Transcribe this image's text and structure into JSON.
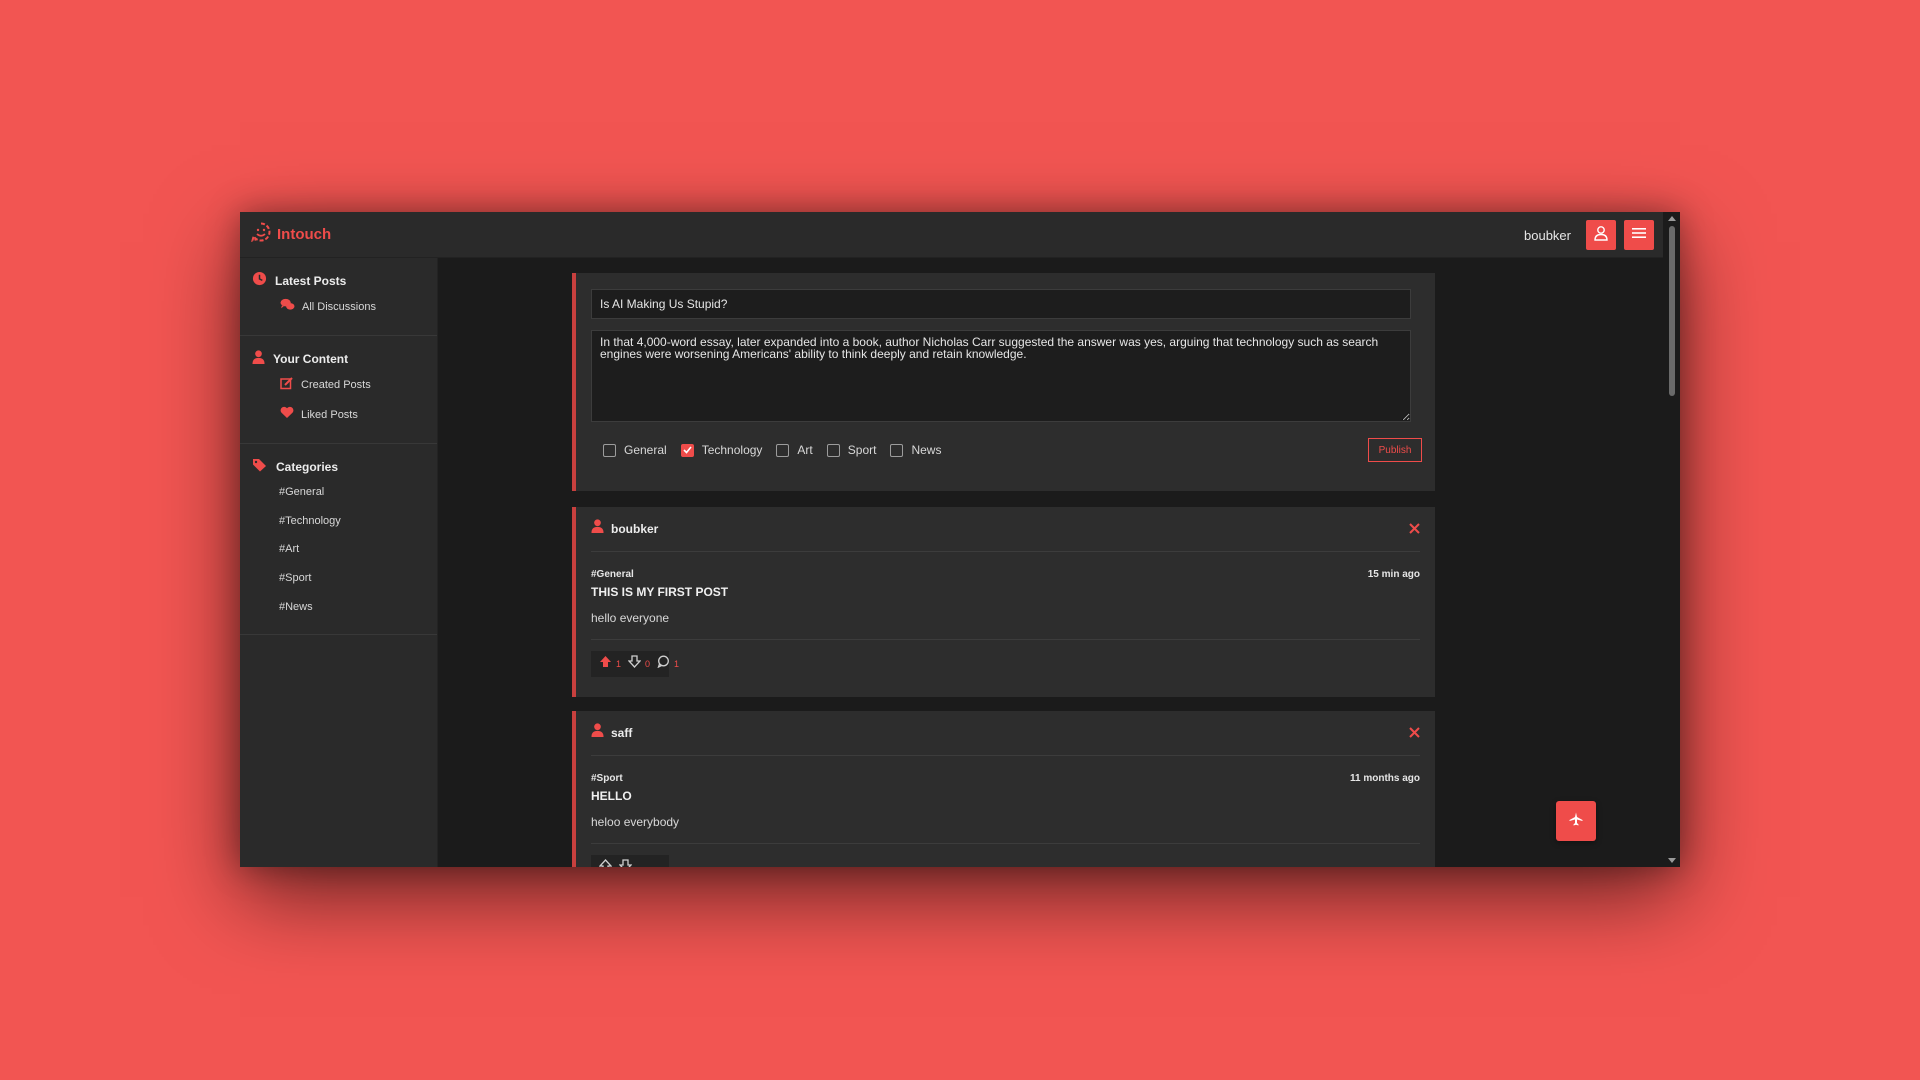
{
  "header": {
    "brand": "Intouch",
    "username": "boubker",
    "icons": {
      "logo": "smiley-chat-icon",
      "profile": "user-icon",
      "menu": "hamburger-icon"
    }
  },
  "sidebar": {
    "latest": {
      "title": "Latest Posts",
      "items": [
        {
          "label": "All Discussions",
          "icon": "discussions-icon"
        }
      ]
    },
    "content": {
      "title": "Your Content",
      "items": [
        {
          "label": "Created Posts",
          "icon": "edit-icon"
        },
        {
          "label": "Liked Posts",
          "icon": "heart-icon"
        }
      ]
    },
    "categories": {
      "title": "Categories",
      "items": [
        "#General",
        "#Technology",
        "#Art",
        "#Sport",
        "#News"
      ]
    }
  },
  "composer": {
    "title_value": "Is AI Making Us Stupid?",
    "body_value": "In that 4,000-word essay, later expanded into a book, author Nicholas Carr suggested the answer was yes, arguing that technology such as search engines were worsening Americans' ability to think deeply and retain knowledge.",
    "categories": [
      {
        "label": "General",
        "checked": false
      },
      {
        "label": "Technology",
        "checked": true
      },
      {
        "label": "Art",
        "checked": false
      },
      {
        "label": "Sport",
        "checked": false
      },
      {
        "label": "News",
        "checked": false
      }
    ],
    "publish_label": "Publish"
  },
  "posts": [
    {
      "author": "boubker",
      "category": "#General",
      "time": "15 min ago",
      "title": "THIS IS MY FIRST POST",
      "body": "hello everyone",
      "likes": "1",
      "dislikes": "0",
      "comments": "1"
    },
    {
      "author": "saff",
      "category": "#Sport",
      "time": "11 months ago",
      "title": "HELLO",
      "body": "heloo everybody",
      "likes": "",
      "dislikes": "",
      "comments": ""
    }
  ],
  "colors": {
    "accent": "#ef4c4a",
    "background": "#f25552",
    "panel": "#2a2a2a",
    "main": "#1b1b1b"
  }
}
